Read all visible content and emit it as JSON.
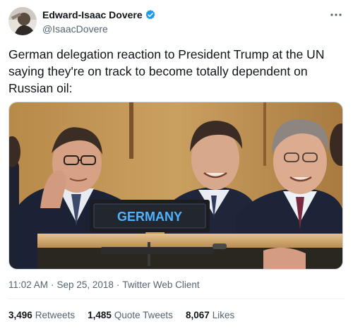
{
  "author": {
    "display_name": "Edward-Isaac Dovere",
    "handle": "@IsaacDovere",
    "verified": true
  },
  "tweet": {
    "text": "German delegation reaction to President Trump at the UN saying they're on track to become totally dependent on Russian oil:"
  },
  "media": {
    "nameplate_text": "GERMANY"
  },
  "meta": {
    "time": "11:02 AM",
    "separator": "·",
    "date": "Sep 25, 2018",
    "client": "Twitter Web Client"
  },
  "stats": {
    "retweets_count": "3,496",
    "retweets_label": "Retweets",
    "quotes_count": "1,485",
    "quotes_label": "Quote Tweets",
    "likes_count": "8,067",
    "likes_label": "Likes"
  },
  "colors": {
    "verified_blue": "#1d9bf0",
    "secondary_text": "#536471",
    "primary_text": "#0f1419"
  },
  "icons": {
    "verified": "verified-badge-icon",
    "more": "more-options-icon"
  }
}
